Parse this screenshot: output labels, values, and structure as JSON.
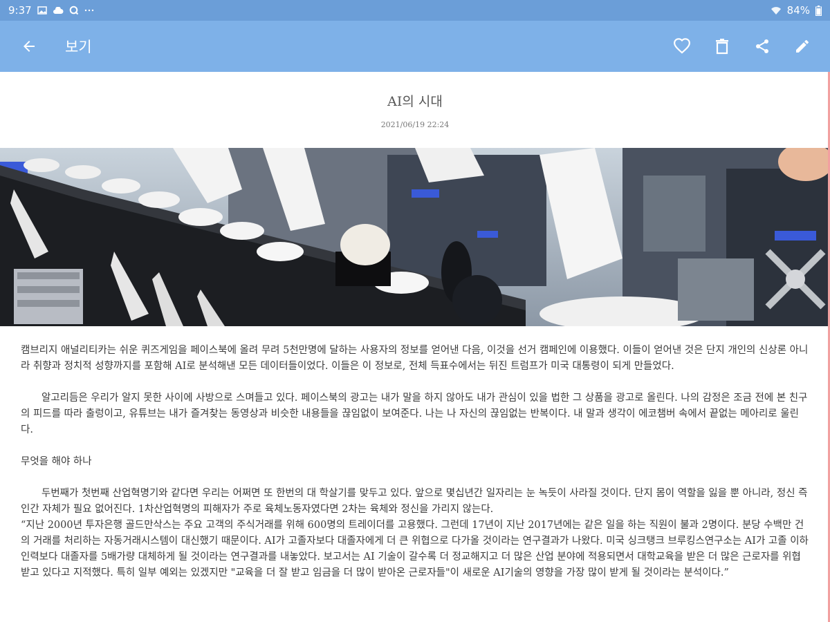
{
  "status_bar": {
    "time": "9:37",
    "battery": "84%",
    "left_icons": [
      "gallery-icon",
      "cloud-icon",
      "q-icon",
      "more-dots-icon"
    ],
    "right_icons": [
      "wifi-icon",
      "battery-icon"
    ]
  },
  "app_bar": {
    "title": "보기",
    "actions": [
      "heart-icon",
      "delete-icon",
      "share-icon",
      "edit-icon"
    ],
    "background": "#7eb1e8"
  },
  "article": {
    "title": "AI의 시대",
    "date": "2021/06/19 22:24",
    "paragraphs": [
      "캠브리지 애널리티카는 쉬운 퀴즈게임을 페이스북에 올려 무려 5천만명에 달하는 사용자의 정보를 얻어낸 다음, 이것을 선거 캠페인에 이용했다. 이들이 얻어낸 것은 단지 개인의 신상론 아니라 취향과 정치적 성향까지를 포함해 AI로 분석해낸 모든 데이터들이었다. 이들은 이 정보로, 전체 득표수에서는 뒤진 트럼프가 미국 대통령이 되게 만들었다.",
      "알고리듬은 우리가 알지 못한 사이에 사방으로 스며들고 있다. 페이스북의 광고는 내가 말을 하지 않아도 내가 관심이 있을 법한 그 상품을 광고로 올린다. 나의 감정은 조금 전에 본 친구의 피드를 따라 출렁이고, 유튜브는 내가 즐겨찾는 동영상과 비슷한 내용들을 끊임없이 보여준다. 나는 나 자신의 끊임없는 반복이다. 내 말과 생각이 에코챔버 속에서 끝없는 메아리로 울린다.",
      "무엇을 해야 하나",
      "두번째가 첫번째 산업혁명기와 같다면 우리는 어쩌면 또 한번의 대 학살기를 맞두고 있다. 앞으로 몇십년간 일자리는 눈 녹듯이 사라질 것이다. 단지 몸이 역할을 잃을 뿐 아니라, 정신 즉 인간 자체가 필요 없어진다. 1차산업혁명의 피해자가 주로 육체노동자였다면 2차는 육체와 정신을 가리지 않는다.",
      "“지난 2000년 투자은행 골드만삭스는 주요 고객의 주식거래를 위해 600명의 트레이더를 고용했다. 그런데 17년이 지난 2017년에는 같은 일을 하는 직원이 불과 2명이다. 분당 수백만 건의 거래를 처리하는 자동거래시스템이 대신했기 때문이다. AI가 고졸자보다 대졸자에게 더 큰 위협으로 다가올 것이라는 연구결과가 나왔다. 미국 싱크탱크 브루킹스연구소는 AI가 고졸 이하 인력보다 대졸자를 5배가량 대체하게 될 것이라는 연구결과를 내놓았다. 보고서는 AI 기술이 갈수록 더 정교해지고 더 많은 산업 분야에 적용되면서 대학교육을 받은 더 많은 근로자를 위협받고 있다고 지적했다. 특히 일부 예외는 있겠지만 \"교육을 더 잘 받고 임금을 더 많이 받아온 근로자들\"이 새로운 AI기술의 영향을 가장 많이 받게 될 것이라는 분석이다.”"
    ]
  }
}
